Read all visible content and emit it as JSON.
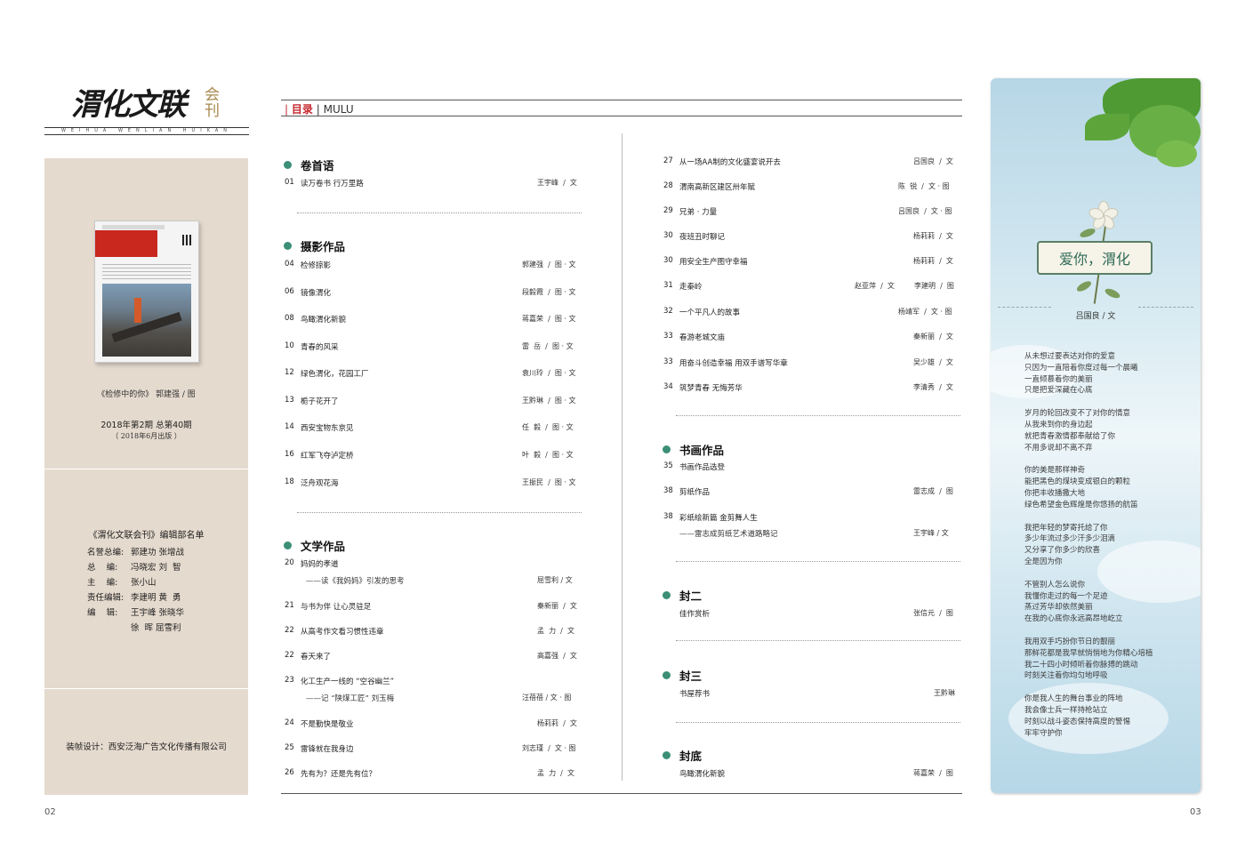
{
  "masthead": {
    "title": "渭化文联",
    "sub": "会刊",
    "pinyin": "WEIHUA WENLIAN HUIKAN"
  },
  "left": {
    "cover_caption": "《检修中的你》 郭建强 / 图",
    "issue": "2018年第2期 总第40期",
    "issue_date": "（ 2018年6月出版 ）",
    "staff_title": "《渭化文联会刊》编辑部名单",
    "staff": [
      {
        "role": "名誉总编:",
        "names": "郭建功 张增战"
      },
      {
        "role": "总    编:",
        "names": "冯晓宏 刘  智"
      },
      {
        "role": "主    编:",
        "names": "张小山"
      },
      {
        "role": "责任编辑:",
        "names": "李建明 黄  勇"
      },
      {
        "role": "编    辑:",
        "names": "王宇峰 张晓华"
      },
      {
        "role": "",
        "names": "徐  晖 屈雪利"
      }
    ],
    "designer": "装帧设计：西安泛海广告文化传播有限公司"
  },
  "toc": {
    "header_cn": "目录",
    "header_en": "MULU",
    "sections": {
      "s1": "卷首语",
      "s2": "摄影作品",
      "s3": "文学作品",
      "s4": "书画作品",
      "s5": "封二",
      "s6": "封三",
      "s7": "封底"
    },
    "left_entries": [
      {
        "num": "01",
        "title": "读万卷书 行万里路",
        "author": "王宇峰  /  文"
      },
      {
        "num": "04",
        "title": "检修掠影",
        "author": "郭建强  /  图 · 文"
      },
      {
        "num": "06",
        "title": "镜像渭化",
        "author": "段毅霞  /  图 · 文"
      },
      {
        "num": "08",
        "title": "鸟瞰渭化新貌",
        "author": "蒋嘉荣  /  图 · 文"
      },
      {
        "num": "10",
        "title": "青春的风采",
        "author": "雷  岳  /  图 · 文"
      },
      {
        "num": "12",
        "title": "绿色渭化，花园工厂",
        "author": "袁川玲  /  图 · 文"
      },
      {
        "num": "13",
        "title": "栀子花开了",
        "author": "王黔琳  /  图 · 文"
      },
      {
        "num": "14",
        "title": "西安宝物东京见",
        "author": "任  毅  /  图 · 文"
      },
      {
        "num": "16",
        "title": "红军飞夺泸定桥",
        "author": "叶  毅  /  图 · 文"
      },
      {
        "num": "18",
        "title": "泛舟观花海",
        "author": "王振民  /  图 · 文"
      },
      {
        "num": "20",
        "title": "妈妈的孝道",
        "author": ""
      },
      {
        "num": "21",
        "title": "与书为伴 让心灵驻足",
        "author": "秦新丽  /  文"
      },
      {
        "num": "22",
        "title": "从高考作文看习惯性违章",
        "author": "孟  力  /  文"
      },
      {
        "num": "22",
        "title": "春天来了",
        "author": "高嘉强  /  文"
      },
      {
        "num": "23",
        "title": "化工生产一线的 “空谷幽兰”",
        "author": ""
      },
      {
        "num": "24",
        "title": "不是勤快是敬业",
        "author": "杨莉莉  /  文"
      },
      {
        "num": "25",
        "title": "雷锋就在我身边",
        "author": "刘志瑾  /  文 · 图"
      },
      {
        "num": "26",
        "title": "先有为？还是先有位？",
        "author": "孟  力  /  文"
      }
    ],
    "left_subs": [
      {
        "text": "——读《我妈妈》引发的思考",
        "author": "屈雪利  /  文"
      },
      {
        "text": "——记 “陕煤工匠” 刘玉梅",
        "author": "汪蓓蓓  /  文 · 图"
      }
    ],
    "right_entries": [
      {
        "num": "27",
        "title": "从一场AA制的文化盛宴说开去",
        "author": "吕国良  /  文"
      },
      {
        "num": "28",
        "title": "渭南高新区建区卅年赋",
        "author": "陈  锐  /  文 · 图"
      },
      {
        "num": "29",
        "title": "兄弟 · 力量",
        "author": "吕国良  /  文 · 图"
      },
      {
        "num": "30",
        "title": "夜班丑时聊记",
        "author": "杨莉莉  /  文"
      },
      {
        "num": "30",
        "title": "用安全生产图守幸福",
        "author": "杨莉莉  /  文"
      },
      {
        "num": "31",
        "title": "走秦岭",
        "author": "赵亚萍  /  文",
        "author2": "李建明  /  图"
      },
      {
        "num": "32",
        "title": "一个平凡人的故事",
        "author": "杨靖军  /  文 · 图"
      },
      {
        "num": "33",
        "title": "春游老城文庙",
        "author": "秦新丽  /  文"
      },
      {
        "num": "33",
        "title": "用奋斗创造幸福  用双手谱写华章",
        "author": "吴少雄  /  文"
      },
      {
        "num": "34",
        "title": "筑梦青春  无悔芳华",
        "author": "李清秀  /  文"
      },
      {
        "num": "35",
        "title": "书画作品选登",
        "author": ""
      },
      {
        "num": "38",
        "title": "剪纸作品",
        "author": "雷志成  /  图"
      },
      {
        "num": "38",
        "title": "彩纸绘新篇  金剪舞人生",
        "author": ""
      },
      {
        "num": "",
        "title": "佳作赏析",
        "author": "张信元  /  图"
      },
      {
        "num": "",
        "title": "书屋荐书",
        "author": "王黔琳"
      },
      {
        "num": "",
        "title": "鸟瞰渭化新貌",
        "author": "蒋嘉荣  /  图"
      }
    ],
    "right_subs": [
      {
        "text": "——雷志成剪纸艺术道路略记",
        "author": "王宇峰  /  文"
      }
    ]
  },
  "poem": {
    "title": "爱你，渭化",
    "author": "吕国良 / 文",
    "stanzas": [
      [
        "从未想过要表达对你的爱意",
        "只因为一直陪着你度过每一个晨曦",
        "一直倾慕着你的美丽",
        "只是把爱深藏在心底"
      ],
      [
        "岁月的轮回改变不了对你的情意",
        "从我来到你的身边起",
        "就把青春激情都奉献给了你",
        "不用多说却不离不弃"
      ],
      [
        "你的美是那样神奇",
        "能把黑色的煤块变成银白的颗粒",
        "你把丰收播撒大地",
        "绿色希望金色辉煌是你悠扬的航笛"
      ],
      [
        "我把年轻的梦寄托给了你",
        "多少年流过多少汗多少泪滴",
        "又分享了你多少的欣喜",
        "全是因为你"
      ],
      [
        "不管别人怎么说你",
        "我懂你走过的每一个足迹",
        "蒸过芳华却依然美丽",
        "在我的心底你永远高昂地屹立"
      ],
      [
        "我用双手巧扮你节日的靓丽",
        "那鲜花都是我早就悄悄地为你精心培植",
        "我二十四小时倾听着你脉搏的跳动",
        "时刻关注着你均匀地呼吸"
      ],
      [
        "你是我人生的舞台事业的阵地",
        "我会像士兵一样持枪站立",
        "时刻以战斗姿态保持高度的警惕",
        "牢牢守护你"
      ]
    ]
  },
  "pages": {
    "left": "02",
    "right": "03"
  }
}
